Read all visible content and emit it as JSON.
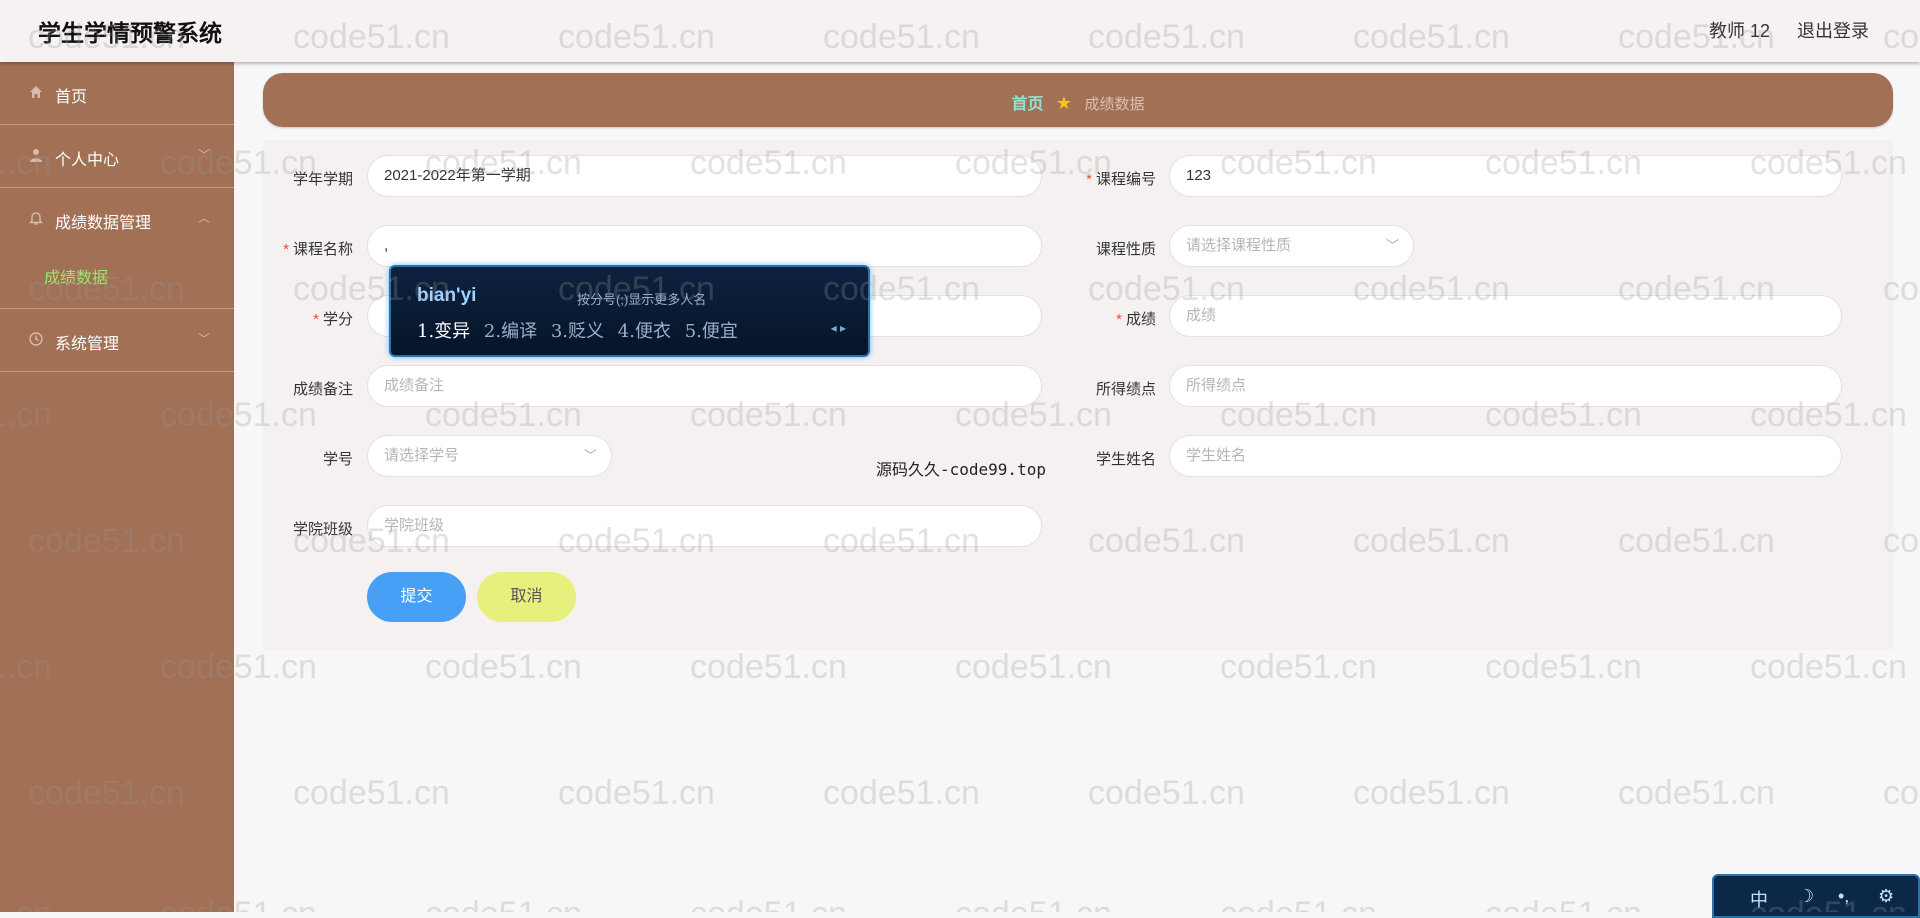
{
  "header": {
    "title": "学生学情预警系统",
    "user": "教师 12",
    "logout": "退出登录"
  },
  "sidebar": {
    "items": [
      {
        "label": "首页",
        "icon": "home-icon"
      },
      {
        "label": "个人中心",
        "icon": "user-icon"
      },
      {
        "label": "成绩数据管理",
        "icon": "bell-icon",
        "children": [
          "成绩数据"
        ]
      },
      {
        "label": "系统管理",
        "icon": "clock-icon"
      }
    ]
  },
  "breadcrumb": {
    "home": "首页",
    "current": "成绩数据"
  },
  "form": {
    "semester": {
      "label": "学年学期",
      "value": "2021-2022年第一学期"
    },
    "course_code": {
      "label": "课程编号",
      "value": "123"
    },
    "course_name": {
      "label": "课程名称",
      "value": ","
    },
    "course_type": {
      "label": "课程性质",
      "placeholder": "请选择课程性质"
    },
    "credit": {
      "label": "学分"
    },
    "score": {
      "label": "成绩",
      "placeholder": "成绩"
    },
    "remark": {
      "label": "成绩备注",
      "placeholder": "成绩备注"
    },
    "gpa": {
      "label": "所得绩点",
      "placeholder": "所得绩点"
    },
    "student_no": {
      "label": "学号",
      "placeholder": "请选择学号"
    },
    "student_name": {
      "label": "学生姓名",
      "placeholder": "学生姓名"
    },
    "class": {
      "label": "学院班级",
      "placeholder": "学院班级"
    },
    "submit": "提交",
    "cancel": "取消"
  },
  "ime": {
    "pinyin": "bian'yi",
    "hint": "按分号(;)显示更多人名",
    "candidates": [
      "1.变异",
      "2.编译",
      "3.贬义",
      "4.便衣",
      "5.便宜"
    ]
  },
  "ime_bar": {
    "labels": [
      "中",
      "☽",
      "•,",
      "⚙"
    ]
  },
  "watermark": {
    "text": "code51.cn",
    "overlay_text": "源码久久-code99.top"
  }
}
